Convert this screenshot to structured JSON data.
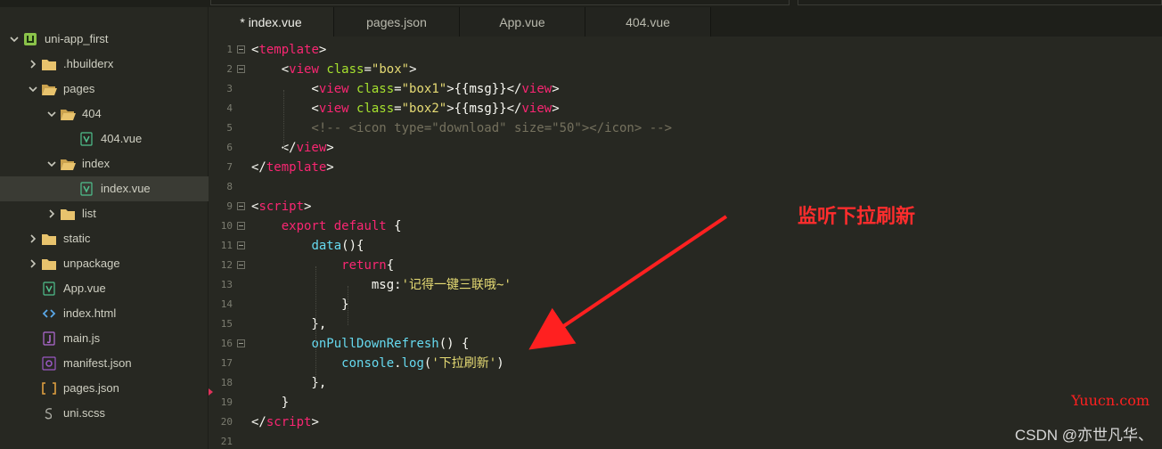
{
  "sidebar": {
    "items": [
      {
        "label": "uni-app_first",
        "icon": "project-icon",
        "expanded": true
      },
      {
        "label": ".hbuilderx",
        "icon": "folder-icon",
        "expanded": false
      },
      {
        "label": "pages",
        "icon": "folder-open-icon",
        "expanded": true
      },
      {
        "label": "404",
        "icon": "folder-open-icon",
        "expanded": true
      },
      {
        "label": "404.vue",
        "icon": "vue-file-icon"
      },
      {
        "label": "index",
        "icon": "folder-open-icon",
        "expanded": true
      },
      {
        "label": "index.vue",
        "icon": "vue-file-icon",
        "selected": true
      },
      {
        "label": "list",
        "icon": "folder-icon",
        "expanded": false
      },
      {
        "label": "static",
        "icon": "folder-icon",
        "expanded": false
      },
      {
        "label": "unpackage",
        "icon": "folder-icon",
        "expanded": false
      },
      {
        "label": "App.vue",
        "icon": "vue-file-icon"
      },
      {
        "label": "index.html",
        "icon": "html-file-icon"
      },
      {
        "label": "main.js",
        "icon": "js-file-icon"
      },
      {
        "label": "manifest.json",
        "icon": "manifest-file-icon"
      },
      {
        "label": "pages.json",
        "icon": "json-file-icon"
      },
      {
        "label": "uni.scss",
        "icon": "scss-file-icon"
      }
    ]
  },
  "tabs": [
    {
      "label": "* index.vue",
      "active": true
    },
    {
      "label": "pages.json",
      "active": false
    },
    {
      "label": "App.vue",
      "active": false
    },
    {
      "label": "404.vue",
      "active": false
    }
  ],
  "editor": {
    "line_numbers": [
      "1",
      "2",
      "3",
      "4",
      "5",
      "6",
      "7",
      "8",
      "9",
      "10",
      "11",
      "12",
      "13",
      "14",
      "15",
      "16",
      "17",
      "18",
      "19",
      "20",
      "21"
    ],
    "lines": [
      [
        [
          "t-pun",
          "<"
        ],
        [
          "t-tag",
          "template"
        ],
        [
          "t-pun",
          ">"
        ]
      ],
      [
        [
          "t-pun",
          "    <"
        ],
        [
          "t-tag",
          "view"
        ],
        [
          "t-pun",
          " "
        ],
        [
          "t-attr",
          "class"
        ],
        [
          "t-pun",
          "="
        ],
        [
          "t-str",
          "\"box\""
        ],
        [
          "t-pun",
          ">"
        ]
      ],
      [
        [
          "t-pun",
          "        <"
        ],
        [
          "t-tag",
          "view"
        ],
        [
          "t-pun",
          " "
        ],
        [
          "t-attr",
          "class"
        ],
        [
          "t-pun",
          "="
        ],
        [
          "t-str",
          "\"box1\""
        ],
        [
          "t-pun",
          ">{{msg}}</"
        ],
        [
          "t-tag",
          "view"
        ],
        [
          "t-pun",
          ">"
        ]
      ],
      [
        [
          "t-pun",
          "        <"
        ],
        [
          "t-tag",
          "view"
        ],
        [
          "t-pun",
          " "
        ],
        [
          "t-attr",
          "class"
        ],
        [
          "t-pun",
          "="
        ],
        [
          "t-str",
          "\"box2\""
        ],
        [
          "t-pun",
          ">{{msg}}</"
        ],
        [
          "t-tag",
          "view"
        ],
        [
          "t-pun",
          ">"
        ]
      ],
      [
        [
          "t-com",
          "        <!-- <icon type=\"download\" size=\"50\"></icon> -->"
        ]
      ],
      [
        [
          "t-pun",
          "    </"
        ],
        [
          "t-tag",
          "view"
        ],
        [
          "t-pun",
          ">"
        ]
      ],
      [
        [
          "t-pun",
          "</"
        ],
        [
          "t-tag",
          "template"
        ],
        [
          "t-pun",
          ">"
        ]
      ],
      [],
      [
        [
          "t-pun",
          "<"
        ],
        [
          "t-tag",
          "script"
        ],
        [
          "t-pun",
          ">"
        ]
      ],
      [
        [
          "t-pun",
          "    "
        ],
        [
          "t-kw",
          "export"
        ],
        [
          "t-pun",
          " "
        ],
        [
          "t-kw",
          "default"
        ],
        [
          "t-pun",
          " {"
        ]
      ],
      [
        [
          "t-pun",
          "        "
        ],
        [
          "t-fn",
          "data"
        ],
        [
          "t-pun",
          "(){"
        ]
      ],
      [
        [
          "t-pun",
          "            "
        ],
        [
          "t-kw",
          "return"
        ],
        [
          "t-pun",
          "{"
        ]
      ],
      [
        [
          "t-pun",
          "                "
        ],
        [
          "t-id",
          "msg"
        ],
        [
          "t-pun",
          ":"
        ],
        [
          "t-str",
          "'记得一键三联哦~'"
        ]
      ],
      [
        [
          "t-pun",
          "            }"
        ]
      ],
      [
        [
          "t-pun",
          "        },"
        ]
      ],
      [
        [
          "t-pun",
          "        "
        ],
        [
          "t-fn",
          "onPullDownRefresh"
        ],
        [
          "t-pun",
          "() {"
        ]
      ],
      [
        [
          "t-pun",
          "            "
        ],
        [
          "t-fn",
          "console"
        ],
        [
          "t-pun",
          "."
        ],
        [
          "t-fn",
          "log"
        ],
        [
          "t-pun",
          "("
        ],
        [
          "t-str",
          "'下拉刷新'"
        ],
        [
          "t-pun",
          ")"
        ]
      ],
      [
        [
          "t-pun",
          "        },"
        ]
      ],
      [
        [
          "t-pun",
          "    }"
        ]
      ],
      [
        [
          "t-pun",
          "</"
        ],
        [
          "t-tag",
          "script"
        ],
        [
          "t-pun",
          ">"
        ]
      ],
      []
    ],
    "foldable_lines": [
      1,
      2,
      9,
      10,
      11,
      12,
      16
    ]
  },
  "annotation": {
    "text": "监听下拉刷新",
    "color": "#ff2d2d"
  },
  "watermarks": {
    "site": "Yuucn.com",
    "author": "CSDN @亦世凡华、"
  }
}
